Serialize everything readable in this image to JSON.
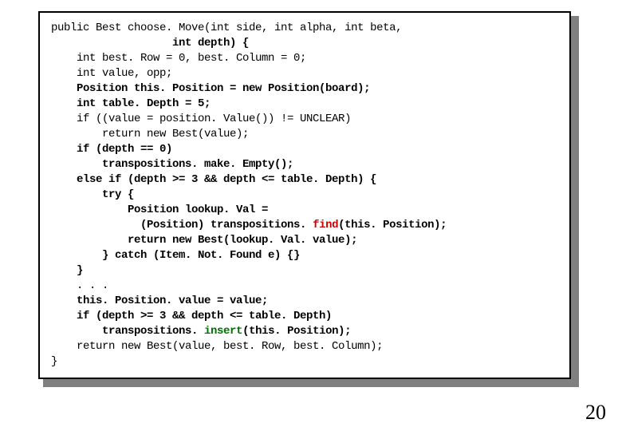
{
  "page_number": "20",
  "code": {
    "l1": "public Best choose. Move(int side, int alpha, int beta,",
    "l2": "                   int depth) {",
    "l3": "    int best. Row = 0, best. Column = 0;",
    "l4": "    int value, opp;",
    "l5": "    Position this. Position = new Position(board);",
    "l6": "    int table. Depth = 5;",
    "l7": "",
    "l8": "    if ((value = position. Value()) != UNCLEAR)",
    "l9": "        return new Best(value);",
    "l10": "    if (depth == 0)",
    "l11": "        transpositions. make. Empty();",
    "l12": "    else if (depth >= 3 && depth <= table. Depth) {",
    "l13": "        try {",
    "l14a": "            Position lookup. Val =\n              (Position) transpositions. ",
    "find": "find",
    "l14b": "(this. Position);",
    "l15": "            return new Best(lookup. Val. value);",
    "l16": "        } catch (Item. Not. Found e) {}",
    "l17": "    }",
    "l18": "    . . .",
    "l19": "    this. Position. value = value;",
    "l20": "    if (depth >= 3 && depth <= table. Depth)",
    "l21a": "        transpositions. ",
    "insert": "insert",
    "l21b": "(this. Position);",
    "l22": "    return new Best(value, best. Row, best. Column);",
    "l23": "}"
  }
}
